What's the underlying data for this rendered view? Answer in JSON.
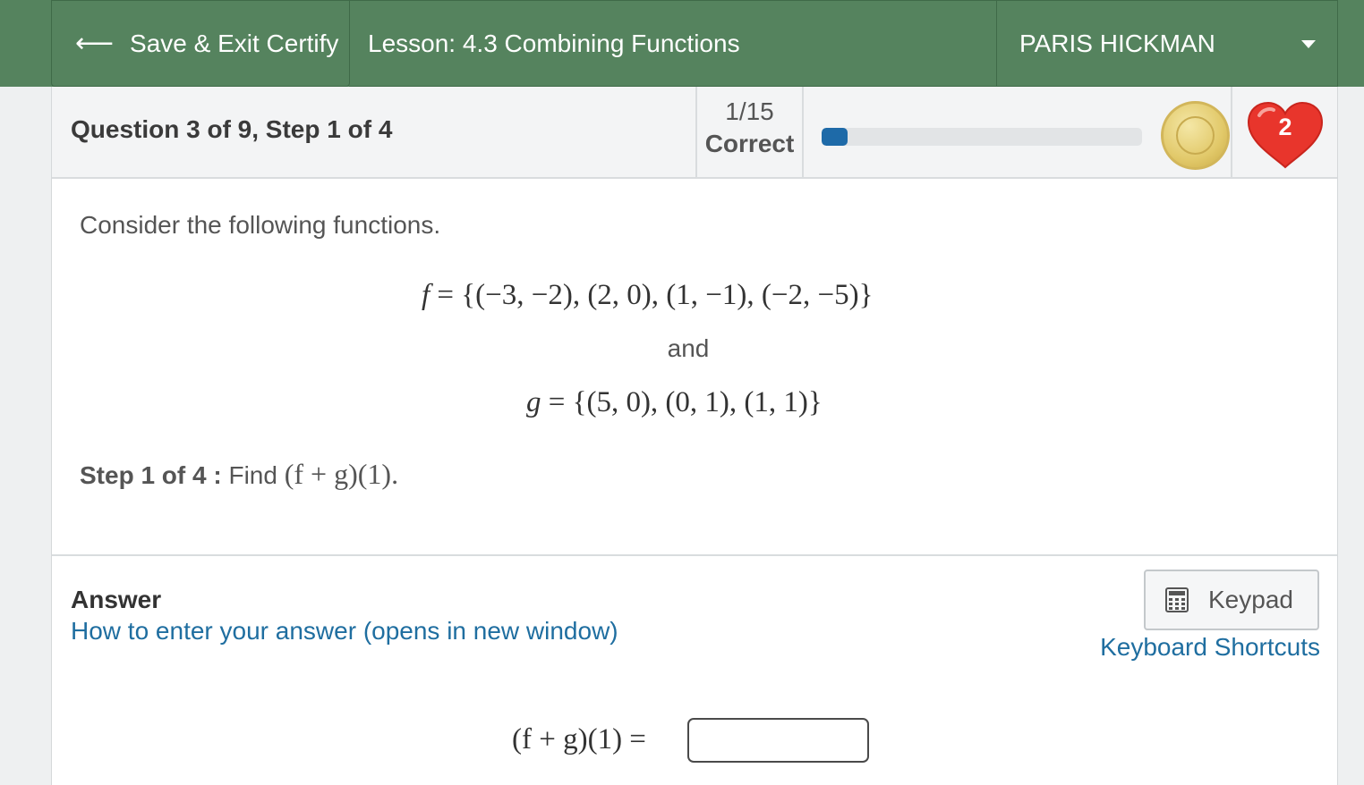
{
  "topbar": {
    "exit_label": "Save & Exit Certify",
    "lesson_label": "Lesson: 4.3 Combining Functions",
    "user_name": "PARIS HICKMAN"
  },
  "status": {
    "question_title": "Question 3 of 9, Step 1 of 4",
    "score_count": "1/15",
    "score_label": "Correct",
    "progress_fraction": 0.08,
    "lives": "2"
  },
  "question": {
    "intro": "Consider the following functions.",
    "f_name": "f",
    "f_set": " = {(−3, −2), (2, 0), (1, −1), (−2, −5)}",
    "and": "and",
    "g_name": "g",
    "g_set": " = {(5, 0), (0, 1), (1, 1)}",
    "step_label": "Step 1 of 4 :",
    "step_find": "Find",
    "step_expr": "(f + g)(1)."
  },
  "answer": {
    "title": "Answer",
    "help_link": "How to enter your answer (opens in new window)",
    "keypad_label": "Keypad",
    "shortcuts_link": "Keyboard Shortcuts",
    "input_label": "(f + g)(1) =",
    "input_value": ""
  },
  "colors": {
    "header_green": "#55835e",
    "link_blue": "#1f6ea0",
    "progress_blue": "#1e6aa8",
    "heart_red": "#e8352c"
  }
}
